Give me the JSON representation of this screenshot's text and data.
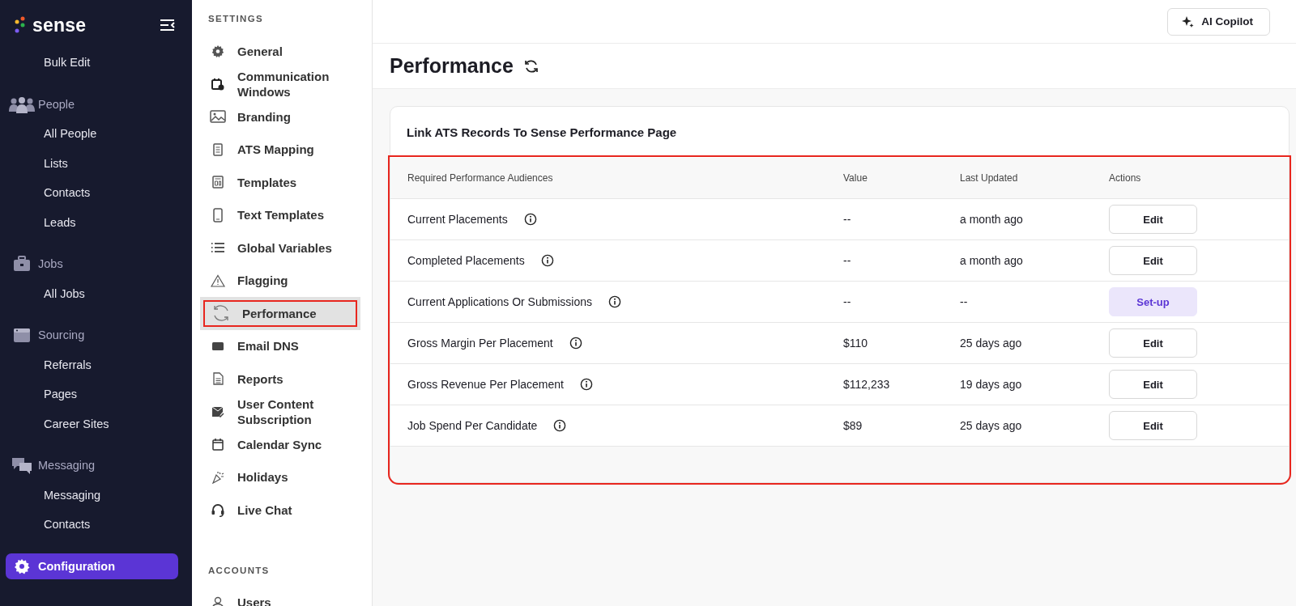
{
  "sidebar": {
    "brand": "sense",
    "items": [
      {
        "label": "Bulk Edit",
        "kind": "link",
        "selected": false
      },
      {
        "label": "People",
        "kind": "section",
        "selected": false
      },
      {
        "label": "All People",
        "kind": "link",
        "selected": false
      },
      {
        "label": "Lists",
        "kind": "link",
        "selected": false
      },
      {
        "label": "Contacts",
        "kind": "link",
        "selected": false
      },
      {
        "label": "Leads",
        "kind": "link",
        "selected": false
      },
      {
        "label": "Jobs",
        "kind": "section",
        "selected": false
      },
      {
        "label": "All Jobs",
        "kind": "link",
        "selected": false
      },
      {
        "label": "Sourcing",
        "kind": "section",
        "selected": false
      },
      {
        "label": "Referrals",
        "kind": "link",
        "selected": false
      },
      {
        "label": "Pages",
        "kind": "link",
        "selected": false
      },
      {
        "label": "Career Sites",
        "kind": "link",
        "selected": false
      },
      {
        "label": "Messaging",
        "kind": "section",
        "selected": false
      },
      {
        "label": "Messaging",
        "kind": "link",
        "selected": false
      },
      {
        "label": "Contacts",
        "kind": "link",
        "selected": false
      },
      {
        "label": "Configuration",
        "kind": "section",
        "selected": true
      }
    ]
  },
  "settings_nav": {
    "sections": [
      {
        "title": "SETTINGS",
        "items": [
          {
            "label": "General",
            "selected": false,
            "highlighted": false
          },
          {
            "label": "Communication Windows",
            "selected": false,
            "highlighted": false
          },
          {
            "label": "Branding",
            "selected": false,
            "highlighted": false
          },
          {
            "label": "ATS Mapping",
            "selected": false,
            "highlighted": false
          },
          {
            "label": "Templates",
            "selected": false,
            "highlighted": false
          },
          {
            "label": "Text Templates",
            "selected": false,
            "highlighted": false
          },
          {
            "label": "Global Variables",
            "selected": false,
            "highlighted": false
          },
          {
            "label": "Flagging",
            "selected": false,
            "highlighted": false
          },
          {
            "label": "Performance",
            "selected": true,
            "highlighted": true
          },
          {
            "label": "Email DNS",
            "selected": false,
            "highlighted": false
          },
          {
            "label": "Reports",
            "selected": false,
            "highlighted": false
          },
          {
            "label": "User Content Subscription",
            "selected": false,
            "highlighted": false
          },
          {
            "label": "Calendar Sync",
            "selected": false,
            "highlighted": false
          },
          {
            "label": "Holidays",
            "selected": false,
            "highlighted": false
          },
          {
            "label": "Live Chat",
            "selected": false,
            "highlighted": false
          }
        ]
      },
      {
        "title": "ACCOUNTS",
        "items": [
          {
            "label": "Users",
            "selected": false,
            "highlighted": false
          }
        ]
      }
    ]
  },
  "header": {
    "copilot_button": "AI Copilot"
  },
  "page": {
    "title": "Performance",
    "card": {
      "title": "Link ATS Records To Sense Performance Page",
      "table": {
        "highlighted": true,
        "columns": [
          "Required Performance Audiences",
          "Value",
          "Last Updated",
          "Actions"
        ],
        "rows": [
          {
            "audience": "Current Placements",
            "value": "--",
            "last_updated": "a month ago",
            "action": {
              "label": "Edit",
              "kind": "edit"
            }
          },
          {
            "audience": "Completed Placements",
            "value": "--",
            "last_updated": "a month ago",
            "action": {
              "label": "Edit",
              "kind": "edit"
            }
          },
          {
            "audience": "Current Applications Or Submissions",
            "value": "--",
            "last_updated": "--",
            "action": {
              "label": "Set-up",
              "kind": "setup"
            }
          },
          {
            "audience": "Gross Margin Per Placement",
            "value": "$110",
            "last_updated": "25 days ago",
            "action": {
              "label": "Edit",
              "kind": "edit"
            }
          },
          {
            "audience": "Gross Revenue Per Placement",
            "value": "$112,233",
            "last_updated": "19 days ago",
            "action": {
              "label": "Edit",
              "kind": "edit"
            }
          },
          {
            "audience": "Job Spend Per Candidate",
            "value": "$89",
            "last_updated": "25 days ago",
            "action": {
              "label": "Edit",
              "kind": "edit"
            }
          }
        ]
      }
    }
  }
}
